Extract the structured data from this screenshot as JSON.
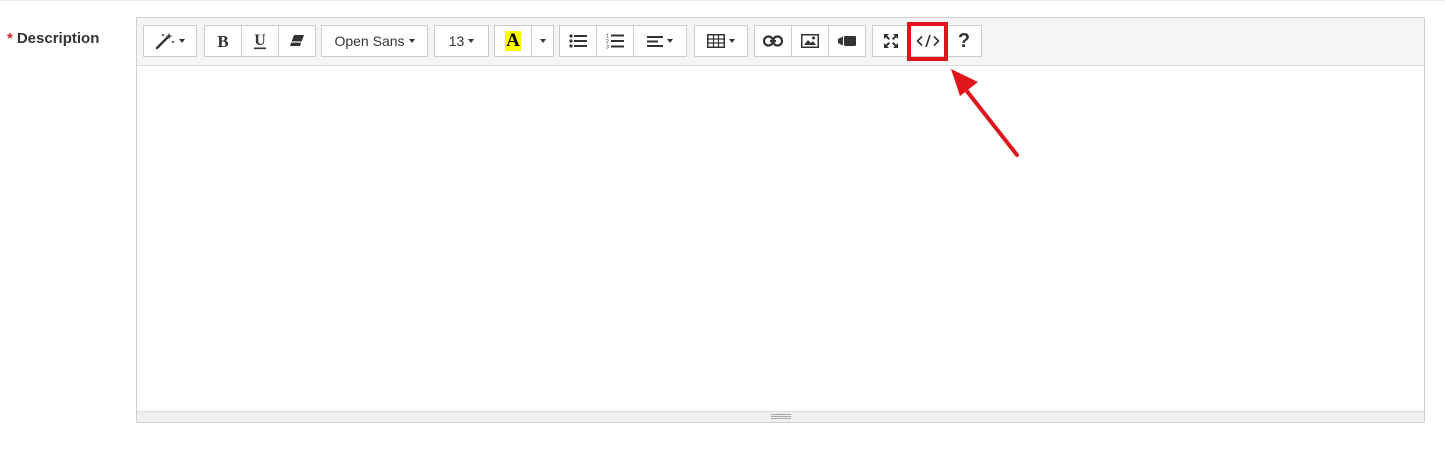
{
  "field": {
    "required_mark": "*",
    "label": "Description"
  },
  "toolbar": {
    "font_family": "Open Sans",
    "font_size": "13",
    "color_letter": "A",
    "highlight_color": "#ffff00",
    "help_label": "?"
  },
  "annotation": {
    "color": "#e0161d",
    "target": "code-view-button"
  }
}
